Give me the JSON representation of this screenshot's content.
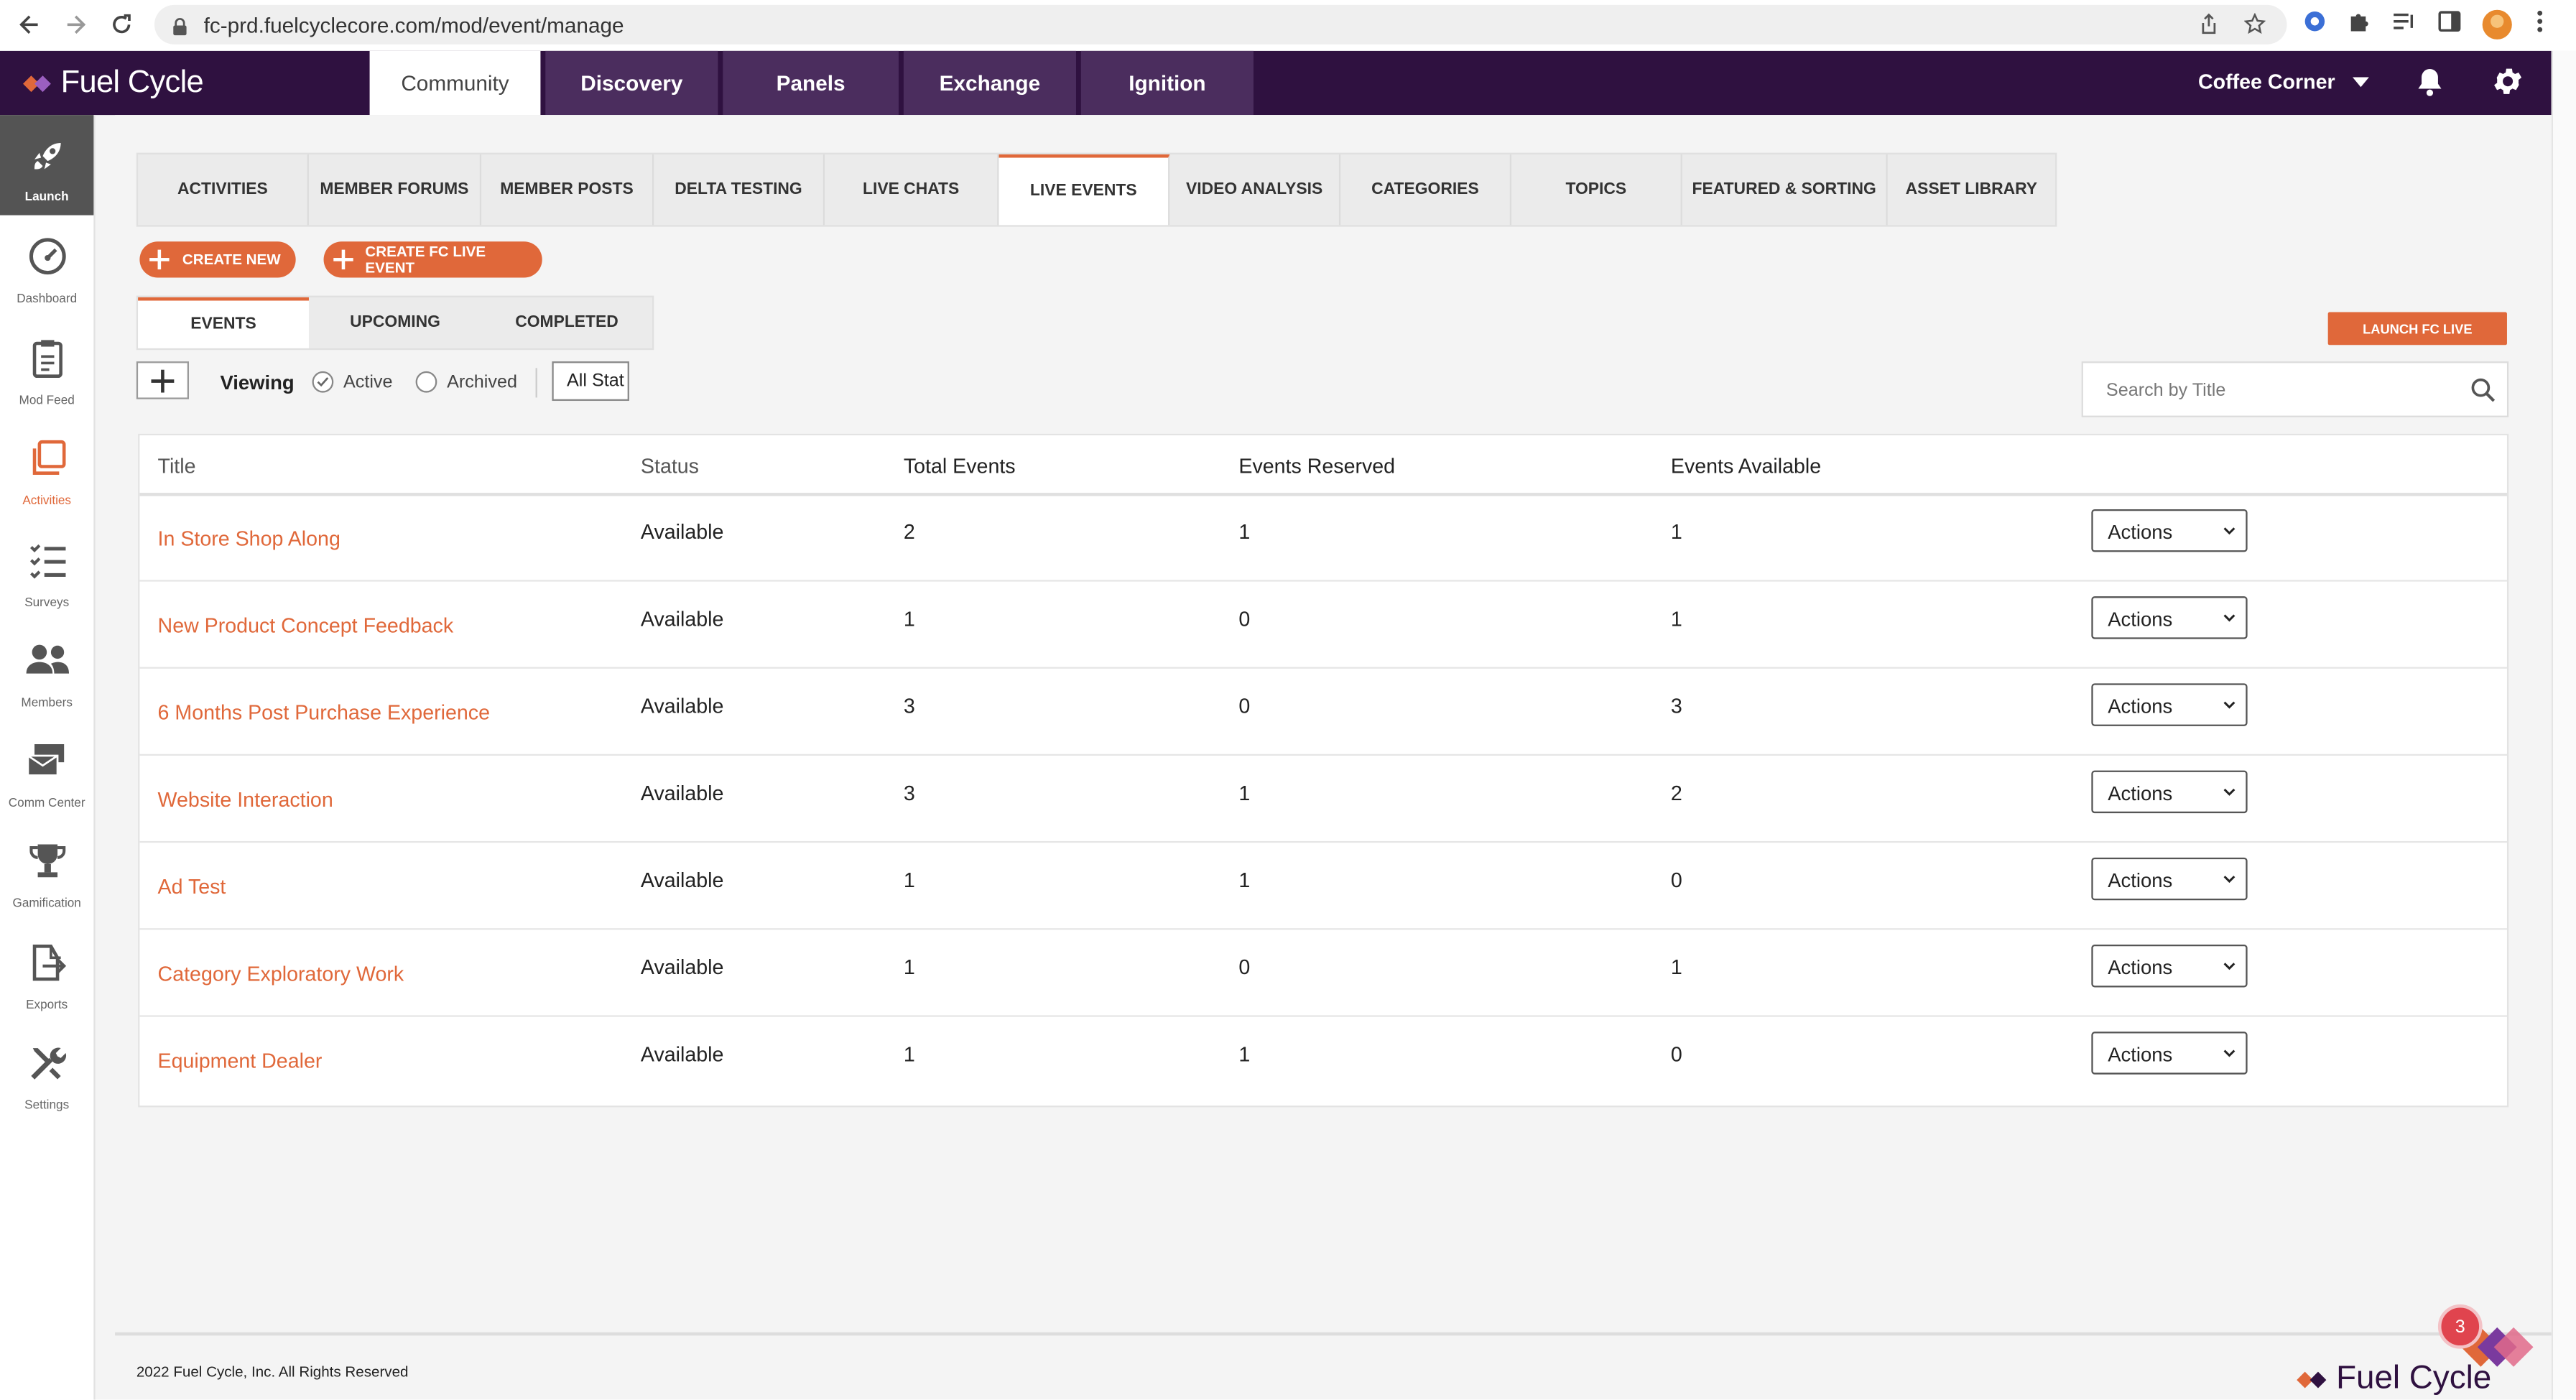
{
  "browser": {
    "url": "fc-prd.fuelcyclecore.com/mod/event/manage"
  },
  "header": {
    "logo_text": "Fuel Cycle",
    "tabs": [
      {
        "label": "Community"
      },
      {
        "label": "Discovery"
      },
      {
        "label": "Panels"
      },
      {
        "label": "Exchange"
      },
      {
        "label": "Ignition"
      }
    ],
    "community_selector": "Coffee Corner"
  },
  "sidebar": {
    "items": [
      {
        "label": "Launch",
        "icon": "rocket-icon"
      },
      {
        "label": "Dashboard",
        "icon": "gauge-icon"
      },
      {
        "label": "Mod Feed",
        "icon": "clipboard-icon"
      },
      {
        "label": "Activities",
        "icon": "stack-icon"
      },
      {
        "label": "Surveys",
        "icon": "checklist-icon"
      },
      {
        "label": "Members",
        "icon": "people-icon"
      },
      {
        "label": "Comm Center",
        "icon": "mail-icon"
      },
      {
        "label": "Gamification",
        "icon": "trophy-icon"
      },
      {
        "label": "Exports",
        "icon": "export-icon"
      },
      {
        "label": "Settings",
        "icon": "tools-icon"
      }
    ]
  },
  "subtabs": [
    {
      "label": "ACTIVITIES"
    },
    {
      "label": "MEMBER FORUMS"
    },
    {
      "label": "MEMBER POSTS"
    },
    {
      "label": "DELTA TESTING"
    },
    {
      "label": "LIVE CHATS"
    },
    {
      "label": "LIVE EVENTS"
    },
    {
      "label": "VIDEO ANALYSIS"
    },
    {
      "label": "CATEGORIES"
    },
    {
      "label": "TOPICS"
    },
    {
      "label": "FEATURED & SORTING"
    },
    {
      "label": "ASSET LIBRARY"
    }
  ],
  "buttons": {
    "create_new": "CREATE NEW",
    "create_fc_live_event": "CREATE FC LIVE EVENT",
    "launch_fc_live": "LAUNCH FC LIVE"
  },
  "filter_tabs": [
    {
      "label": "EVENTS"
    },
    {
      "label": "UPCOMING"
    },
    {
      "label": "COMPLETED"
    }
  ],
  "viewing": {
    "label": "Viewing",
    "active_label": "Active",
    "archived_label": "Archived",
    "status_select": "All Stat"
  },
  "search": {
    "placeholder": "Search by Title"
  },
  "table": {
    "headers": [
      "Title",
      "Status",
      "Total Events",
      "Events Reserved",
      "Events Available"
    ],
    "action_label": "Actions",
    "rows": [
      {
        "title": "In Store Shop Along",
        "status": "Available",
        "total": "2",
        "reserved": "1",
        "available": "1"
      },
      {
        "title": "New Product Concept Feedback",
        "status": "Available",
        "total": "1",
        "reserved": "0",
        "available": "1"
      },
      {
        "title": "6 Months Post Purchase Experience",
        "status": "Available",
        "total": "3",
        "reserved": "0",
        "available": "3"
      },
      {
        "title": "Website Interaction",
        "status": "Available",
        "total": "3",
        "reserved": "1",
        "available": "2"
      },
      {
        "title": "Ad Test",
        "status": "Available",
        "total": "1",
        "reserved": "1",
        "available": "0"
      },
      {
        "title": "Category Exploratory Work",
        "status": "Available",
        "total": "1",
        "reserved": "0",
        "available": "1"
      },
      {
        "title": "Equipment Dealer",
        "status": "Available",
        "total": "1",
        "reserved": "1",
        "available": "0"
      }
    ]
  },
  "footer": {
    "copyright": "2022 Fuel Cycle, Inc. All Rights Reserved",
    "logo_text": "Fuel Cycle",
    "notification_count": "3"
  },
  "colors": {
    "brand_purple": "#2f1140",
    "accent_orange": "#e0683a"
  }
}
